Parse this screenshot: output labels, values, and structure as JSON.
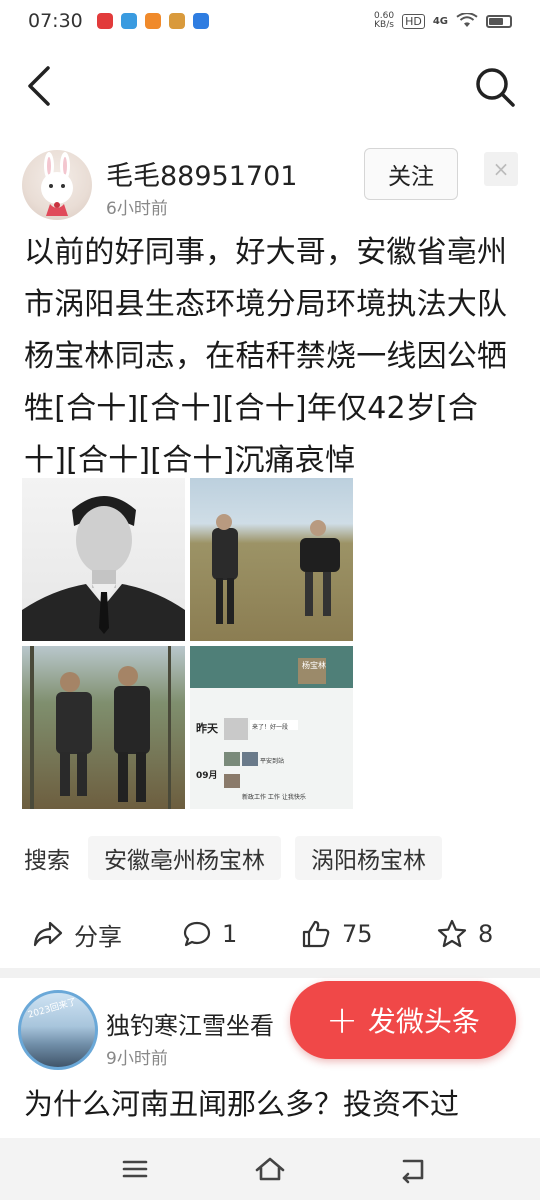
{
  "status_bar": {
    "time": "07:30",
    "net_speed_value": "0.60",
    "net_speed_unit": "KB/s",
    "hd_label": "HD",
    "signal_label": "4G"
  },
  "post": {
    "author": "毛毛88951701",
    "time": "6小时前",
    "follow_label": "关注",
    "close_label": "×",
    "text": "以前的好同事，好大哥，安徽省亳州市涡阳县生态环境分局环境执法大队杨宝林同志，在秸秆禁烧一线因公牺牲[合十][合十][合十]年仅42岁[合十][合十][合十]沉痛哀悼",
    "images": {
      "chat_name": "杨宝林",
      "chat_day": "昨天",
      "chat_date": "09月",
      "chat_msg_1": "来了！好一段",
      "chat_msg_2": "平安到站",
      "chat_msg_3": "新政工作 工作 让我快乐"
    }
  },
  "tags": {
    "label": "搜索",
    "items": [
      "安徽亳州杨宝林",
      "涡阳杨宝林"
    ]
  },
  "actions": {
    "share_label": "分享",
    "comment_count": "1",
    "like_count": "75",
    "favorite_count": "8"
  },
  "next_post": {
    "author": "独钓寒江雪坐看",
    "time": "9小时前",
    "text": "为什么河南丑闻那么多？投资不过",
    "avatar_label": "2023回来了"
  },
  "fab": {
    "plus": "+",
    "label": "发微头条",
    "color": "#f04848"
  }
}
